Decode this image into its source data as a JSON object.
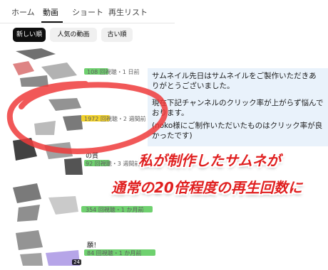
{
  "tabs": [
    {
      "label": "ホーム"
    },
    {
      "label": "動画"
    },
    {
      "label": "ショート"
    },
    {
      "label": "再生リスト"
    }
  ],
  "sort_chips": [
    {
      "label": "新しい順"
    },
    {
      "label": "人気の動画"
    },
    {
      "label": "古い順"
    }
  ],
  "videos": [
    {
      "stats": "108 回視聴・1 日前",
      "highlight": "#6fd16f"
    },
    {
      "stats": "1972 回視聴・2 週間前",
      "highlight": "#f2d22b"
    },
    {
      "title_fragment": "の質",
      "stats": "92 回視聴・3 週間前",
      "highlight": "#6fd16f"
    },
    {
      "stats": "354 回視聴・1 か月前",
      "highlight": "#6fd16f"
    },
    {
      "title_fragment": "願！",
      "stats": "84 回視聴・1 か月前",
      "highlight": "#6fd16f",
      "badge": "24"
    }
  ],
  "comment": {
    "line1": "サムネイル先日はサムネイルをご製作いただきありがとうございました。",
    "line2": "現在下記チャンネルのクリック率が上がらず悩んでおります。",
    "line3": "(noko様にご制作いただいたものはクリック率が良かったです)"
  },
  "annotation": {
    "line1": "私が制作したサムネが",
    "line2": "通常の20倍程度の再生回数に"
  },
  "colors": {
    "annotation_red": "#e02020",
    "circle_red": "#ef3b3b",
    "comment_bg": "#e9f2fb"
  }
}
